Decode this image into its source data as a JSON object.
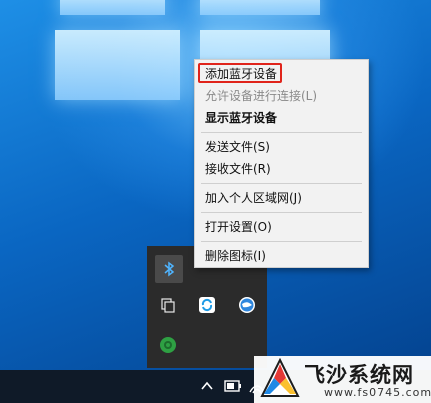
{
  "context_menu": {
    "items": [
      {
        "label": "添加蓝牙设备",
        "state": "highlighted"
      },
      {
        "label": "允许设备进行连接(L)",
        "state": "disabled"
      },
      {
        "label": "显示蓝牙设备",
        "state": "bold"
      },
      {
        "label": "发送文件(S)",
        "state": "normal"
      },
      {
        "label": "接收文件(R)",
        "state": "normal"
      },
      {
        "label": "加入个人区域网(J)",
        "state": "normal"
      },
      {
        "label": "打开设置(O)",
        "state": "normal"
      },
      {
        "label": "删除图标(I)",
        "state": "normal"
      }
    ],
    "highlight_color": "#e0241b"
  },
  "tray": {
    "icons": [
      "bluetooth-icon",
      "copy-icon",
      "sync-icon",
      "globe-icon",
      "green-app-icon"
    ]
  },
  "taskbar": {
    "icons": [
      "chevron-up-icon",
      "battery-icon",
      "wifi-icon"
    ]
  },
  "watermark": {
    "title": "飞沙系统网",
    "url": "www.fs0745.com"
  }
}
